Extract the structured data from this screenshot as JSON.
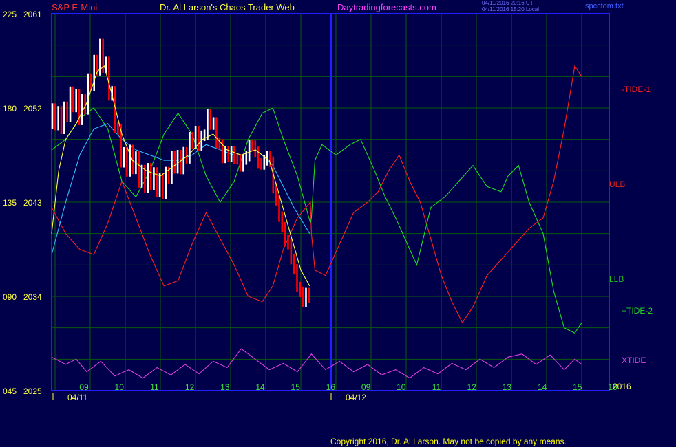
{
  "header": {
    "symbol": "S&P E-Mini",
    "title": "Dr. Al Larson's Chaos Trader Web",
    "site": "Daytradingforecasts.com",
    "ts_utc": "04/11/2016 20:16 UT",
    "ts_local": "04/11/2016 15:20 Local",
    "file": "spcctom.txt"
  },
  "footer": {
    "copyright": "Copyright 2016, Dr. Al Larson. May not be copied by any means."
  },
  "colors": {
    "background": "#00004a",
    "frame": "#2020ff",
    "grid": "#0a5a0a",
    "price_up": "#ffffff",
    "price_down": "#ff0000",
    "tide1": "#ff2020",
    "tide2": "#20dd20",
    "ulb": "#e02020",
    "llb": "#20c020",
    "xtide": "#e040e0",
    "ma_yellow": "#ffff40",
    "ma_cyan": "#30c0ff"
  },
  "chart_data": {
    "type": "line",
    "y_left_labels": [
      "225",
      "180",
      "135",
      "090",
      "045"
    ],
    "y_right_labels": [
      "2061",
      "2052",
      "2043",
      "2034",
      "2025"
    ],
    "ylim": [
      2025,
      2061
    ],
    "x_hour_labels": [
      "09",
      "10",
      "11",
      "12",
      "13",
      "14",
      "15",
      "16",
      "09",
      "10",
      "11",
      "12",
      "13",
      "14",
      "15",
      "16"
    ],
    "date_labels": [
      "04/11",
      "04/12"
    ],
    "year_label": "2016",
    "series_labels": {
      "tide1": "-TIDE-1",
      "ulb": "ULB",
      "llb": "LLB",
      "tide2": "+TIDE-2",
      "xtide": "XTIDE"
    },
    "price_path": [
      [
        8.6,
        2050.5
      ],
      [
        8.8,
        2051.0
      ],
      [
        9.0,
        2052.0
      ],
      [
        9.2,
        2052.4
      ],
      [
        9.4,
        2052.0
      ],
      [
        9.6,
        2053.5
      ],
      [
        9.8,
        2055.0
      ],
      [
        10.0,
        2058.0
      ],
      [
        10.1,
        2057.0
      ],
      [
        10.2,
        2054.5
      ],
      [
        10.35,
        2051.5
      ],
      [
        10.5,
        2049.0
      ],
      [
        10.7,
        2047.0
      ],
      [
        10.9,
        2046.5
      ],
      [
        11.1,
        2046.0
      ],
      [
        11.3,
        2045.5
      ],
      [
        11.5,
        2044.5
      ],
      [
        11.7,
        2045.0
      ],
      [
        11.9,
        2045.5
      ],
      [
        12.1,
        2046.5
      ],
      [
        12.3,
        2047.5
      ],
      [
        12.5,
        2048.0
      ],
      [
        12.7,
        2049.0
      ],
      [
        12.9,
        2049.5
      ],
      [
        13.0,
        2051.0
      ],
      [
        13.1,
        2050.5
      ],
      [
        13.3,
        2049.0
      ],
      [
        13.5,
        2048.0
      ],
      [
        13.7,
        2047.0
      ],
      [
        13.9,
        2047.0
      ],
      [
        14.1,
        2047.5
      ],
      [
        14.3,
        2048.0
      ],
      [
        14.5,
        2047.0
      ],
      [
        14.7,
        2047.5
      ],
      [
        14.8,
        2047.0
      ],
      [
        14.9,
        2044.0
      ],
      [
        15.1,
        2042.0
      ],
      [
        15.3,
        2039.0
      ],
      [
        15.5,
        2036.0
      ],
      [
        15.7,
        2034.5
      ],
      [
        15.9,
        2033.8
      ]
    ],
    "ma_yellow": [
      [
        8.6,
        2040.0
      ],
      [
        8.8,
        2046.0
      ],
      [
        9.0,
        2049.0
      ],
      [
        9.3,
        2050.5
      ],
      [
        9.6,
        2052.5
      ],
      [
        9.9,
        2055.5
      ],
      [
        10.1,
        2056.0
      ],
      [
        10.3,
        2053.5
      ],
      [
        10.6,
        2049.5
      ],
      [
        10.9,
        2047.0
      ],
      [
        11.3,
        2046.0
      ],
      [
        11.7,
        2045.5
      ],
      [
        12.1,
        2046.5
      ],
      [
        12.5,
        2047.5
      ],
      [
        12.9,
        2049.0
      ],
      [
        13.2,
        2049.5
      ],
      [
        13.6,
        2048.0
      ],
      [
        14.0,
        2047.5
      ],
      [
        14.4,
        2048.0
      ],
      [
        14.8,
        2047.0
      ],
      [
        15.1,
        2043.5
      ],
      [
        15.4,
        2040.0
      ],
      [
        15.7,
        2036.5
      ],
      [
        15.95,
        2035.0
      ]
    ],
    "ma_cyan": [
      [
        8.6,
        2038.0
      ],
      [
        9.0,
        2043.0
      ],
      [
        9.4,
        2047.5
      ],
      [
        9.8,
        2050.0
      ],
      [
        10.2,
        2050.5
      ],
      [
        10.6,
        2049.0
      ],
      [
        11.0,
        2048.0
      ],
      [
        11.4,
        2047.5
      ],
      [
        11.8,
        2047.0
      ],
      [
        12.2,
        2047.0
      ],
      [
        12.6,
        2047.5
      ],
      [
        13.0,
        2048.5
      ],
      [
        13.4,
        2048.0
      ],
      [
        13.8,
        2047.5
      ],
      [
        14.2,
        2047.5
      ],
      [
        14.6,
        2047.5
      ],
      [
        14.9,
        2046.5
      ],
      [
        15.2,
        2044.5
      ],
      [
        15.5,
        2042.5
      ],
      [
        15.95,
        2040.0
      ]
    ],
    "tide1": [
      [
        8.6,
        2042.5
      ],
      [
        9.0,
        2040.0
      ],
      [
        9.4,
        2038.5
      ],
      [
        9.8,
        2038.0
      ],
      [
        10.2,
        2041.0
      ],
      [
        10.6,
        2045.0
      ],
      [
        11.0,
        2041.5
      ],
      [
        11.4,
        2038.0
      ],
      [
        11.8,
        2035.0
      ],
      [
        12.2,
        2035.5
      ],
      [
        12.6,
        2039.0
      ],
      [
        13.0,
        2042.0
      ],
      [
        13.4,
        2039.5
      ],
      [
        13.8,
        2037.0
      ],
      [
        14.2,
        2034.0
      ],
      [
        14.6,
        2033.5
      ],
      [
        14.9,
        2035.0
      ],
      [
        15.2,
        2038.5
      ],
      [
        15.6,
        2041.5
      ],
      [
        15.97,
        2043.0
      ],
      [
        16.0,
        2040.0
      ],
      [
        16.1,
        2036.5
      ],
      [
        16.4,
        2036.0
      ],
      [
        16.8,
        2039.0
      ],
      [
        17.2,
        2042.0
      ],
      [
        17.6,
        2043.0
      ],
      [
        17.9,
        2044.0
      ],
      [
        18.2,
        2046.0
      ],
      [
        18.5,
        2047.5
      ],
      [
        18.8,
        2045.0
      ],
      [
        19.1,
        2043.0
      ],
      [
        19.4,
        2039.5
      ],
      [
        19.7,
        2036.0
      ],
      [
        20.0,
        2033.5
      ],
      [
        20.3,
        2031.5
      ],
      [
        20.6,
        2033.0
      ],
      [
        21.0,
        2036.0
      ],
      [
        21.4,
        2037.5
      ],
      [
        21.8,
        2039.0
      ],
      [
        22.2,
        2040.5
      ],
      [
        22.6,
        2041.5
      ],
      [
        22.9,
        2045.0
      ],
      [
        23.2,
        2050.0
      ],
      [
        23.5,
        2056.0
      ],
      [
        23.7,
        2055.0
      ]
    ],
    "tide2": [
      [
        8.6,
        2048.0
      ],
      [
        9.0,
        2049.0
      ],
      [
        9.4,
        2051.0
      ],
      [
        9.8,
        2052.0
      ],
      [
        10.2,
        2050.0
      ],
      [
        10.6,
        2045.0
      ],
      [
        11.0,
        2043.5
      ],
      [
        11.4,
        2046.0
      ],
      [
        11.8,
        2049.5
      ],
      [
        12.2,
        2051.5
      ],
      [
        12.6,
        2049.5
      ],
      [
        13.0,
        2045.5
      ],
      [
        13.4,
        2043.0
      ],
      [
        13.8,
        2045.0
      ],
      [
        14.2,
        2049.0
      ],
      [
        14.6,
        2051.5
      ],
      [
        14.9,
        2052.0
      ],
      [
        15.2,
        2049.0
      ],
      [
        15.6,
        2045.5
      ],
      [
        15.97,
        2041.0
      ],
      [
        16.0,
        2041.5
      ],
      [
        16.1,
        2047.0
      ],
      [
        16.3,
        2048.5
      ],
      [
        16.7,
        2047.5
      ],
      [
        17.1,
        2048.5
      ],
      [
        17.4,
        2049.0
      ],
      [
        17.8,
        2046.0
      ],
      [
        18.1,
        2043.5
      ],
      [
        18.4,
        2041.5
      ],
      [
        18.8,
        2038.5
      ],
      [
        19.0,
        2037.0
      ],
      [
        19.4,
        2042.5
      ],
      [
        19.8,
        2043.5
      ],
      [
        20.2,
        2045.0
      ],
      [
        20.6,
        2046.5
      ],
      [
        21.0,
        2044.5
      ],
      [
        21.4,
        2044.0
      ],
      [
        21.6,
        2045.5
      ],
      [
        21.9,
        2046.5
      ],
      [
        22.2,
        2043.0
      ],
      [
        22.6,
        2040.0
      ],
      [
        22.9,
        2034.5
      ],
      [
        23.2,
        2031.0
      ],
      [
        23.5,
        2030.5
      ],
      [
        23.7,
        2031.5
      ]
    ],
    "xtide": [
      [
        8.6,
        2028.2
      ],
      [
        9.0,
        2027.5
      ],
      [
        9.3,
        2028.0
      ],
      [
        9.6,
        2026.8
      ],
      [
        10.0,
        2027.8
      ],
      [
        10.4,
        2026.4
      ],
      [
        10.8,
        2027.0
      ],
      [
        11.2,
        2026.2
      ],
      [
        11.6,
        2027.2
      ],
      [
        12.0,
        2026.5
      ],
      [
        12.4,
        2027.5
      ],
      [
        12.8,
        2026.6
      ],
      [
        13.2,
        2027.8
      ],
      [
        13.6,
        2027.2
      ],
      [
        14.0,
        2029.0
      ],
      [
        14.4,
        2028.0
      ],
      [
        14.8,
        2027.0
      ],
      [
        15.2,
        2027.6
      ],
      [
        15.6,
        2026.8
      ],
      [
        16.0,
        2028.5
      ],
      [
        16.4,
        2027.0
      ],
      [
        16.8,
        2027.8
      ],
      [
        17.2,
        2026.8
      ],
      [
        17.6,
        2027.5
      ],
      [
        18.0,
        2026.5
      ],
      [
        18.4,
        2027.0
      ],
      [
        18.8,
        2026.2
      ],
      [
        19.2,
        2027.2
      ],
      [
        19.6,
        2026.6
      ],
      [
        20.0,
        2027.6
      ],
      [
        20.4,
        2027.0
      ],
      [
        20.8,
        2028.0
      ],
      [
        21.2,
        2027.2
      ],
      [
        21.6,
        2028.2
      ],
      [
        22.0,
        2028.5
      ],
      [
        22.4,
        2027.5
      ],
      [
        22.8,
        2028.4
      ],
      [
        23.2,
        2027.0
      ],
      [
        23.5,
        2028.0
      ],
      [
        23.7,
        2027.5
      ]
    ]
  }
}
